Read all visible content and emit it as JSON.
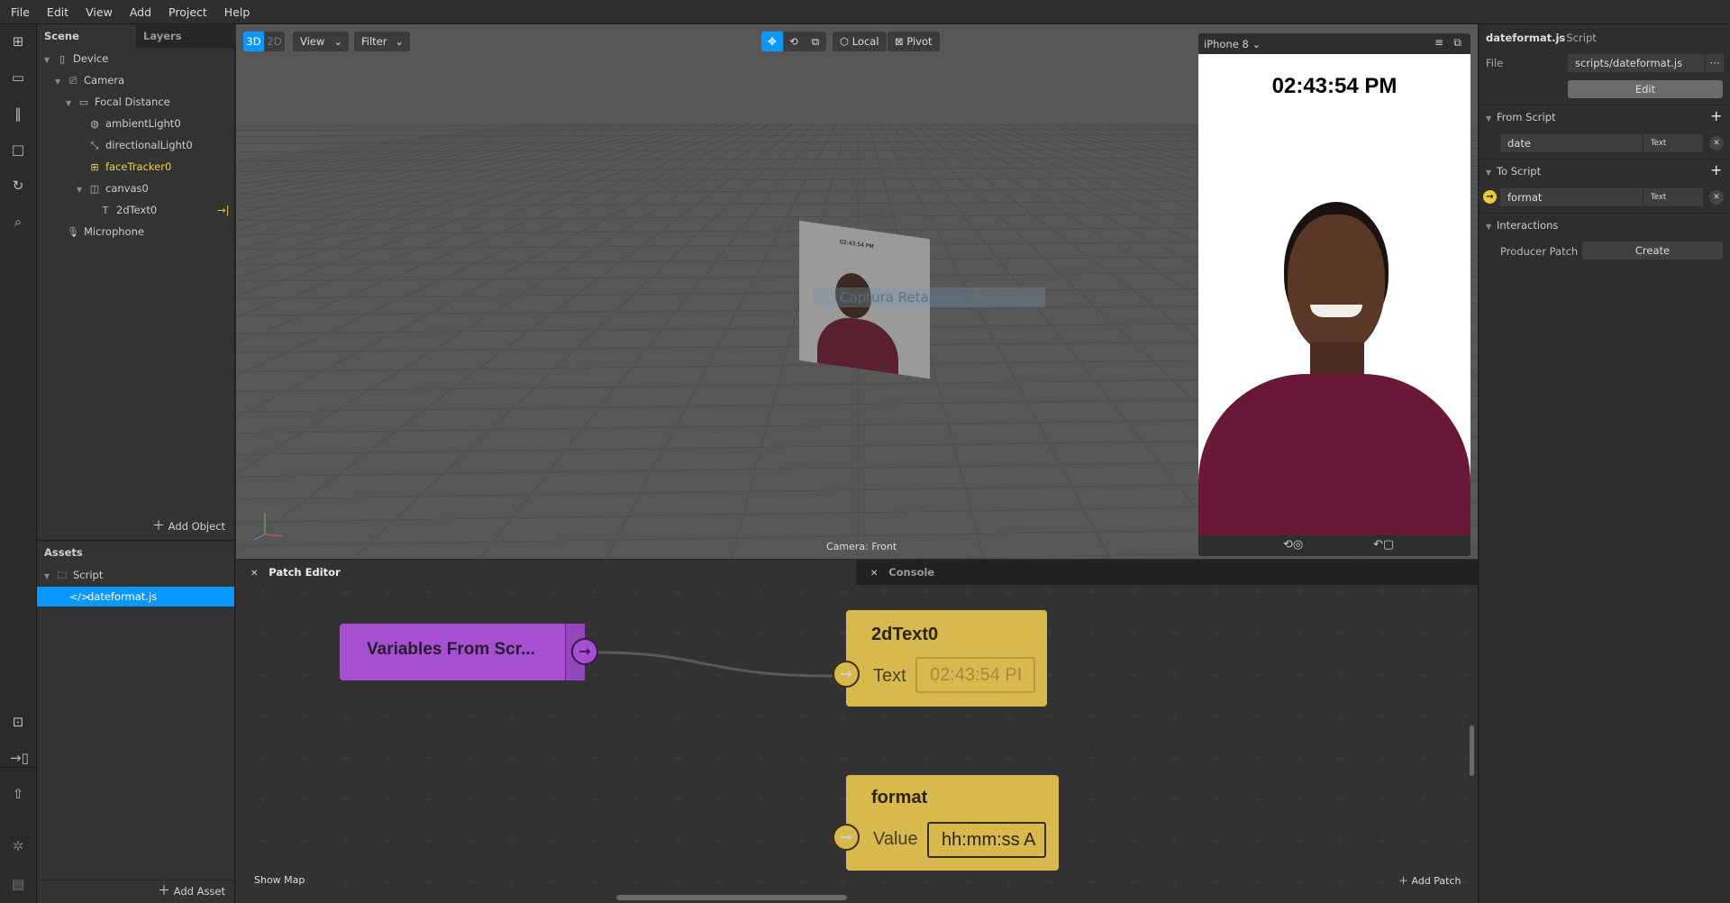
{
  "menu": [
    "File",
    "Edit",
    "View",
    "Add",
    "Project",
    "Help"
  ],
  "scene_panel": {
    "tabs": [
      "Scene",
      "Layers"
    ],
    "tree": [
      {
        "label": "Device",
        "icon": "phone-icon",
        "level": 0,
        "expanded": true
      },
      {
        "label": "Camera",
        "icon": "camera-icon",
        "level": 1,
        "expanded": true
      },
      {
        "label": "Focal Distance",
        "icon": "ruler-icon",
        "level": 2,
        "expanded": true
      },
      {
        "label": "ambientLight0",
        "icon": "globe-icon",
        "level": 3
      },
      {
        "label": "directionalLight0",
        "icon": "directional-light-icon",
        "level": 3
      },
      {
        "label": "faceTracker0",
        "icon": "face-tracker-icon",
        "level": 3,
        "highlight": "#e8d34a"
      },
      {
        "label": "canvas0",
        "icon": "canvas-icon",
        "level": 3,
        "expanded": true
      },
      {
        "label": "2dText0",
        "icon": "text-icon",
        "level": 4,
        "badge": "→|"
      },
      {
        "label": "Microphone",
        "icon": "microphone-icon",
        "level": 1
      }
    ],
    "add_object": "Add Object"
  },
  "assets_panel": {
    "title": "Assets",
    "folder": "Script",
    "file": "dateformat.js",
    "add_asset": "Add Asset"
  },
  "viewport": {
    "mode_3d": "3D",
    "mode_2d": "2D",
    "view": "View",
    "filter": "Filter",
    "local": "Local",
    "pivot": "Pivot",
    "camera_label": "Camera: Front",
    "plane_text": "02:43:54 PM",
    "overlay_text": "Captura Retangular"
  },
  "preview": {
    "device": "iPhone 8",
    "time_text": "02:43:54 PM"
  },
  "inspector": {
    "title": "dateformat.js",
    "subtitle": "– Script",
    "file_label": "File",
    "file_value": "scripts/dateformat.js",
    "more": "···",
    "edit": "Edit",
    "from_script": {
      "title": "From Script",
      "name": "date",
      "type": "Text"
    },
    "to_script": {
      "title": "To Script",
      "name": "format",
      "type": "Text"
    },
    "interactions": {
      "title": "Interactions",
      "producer_label": "Producer Patch",
      "create": "Create"
    }
  },
  "patch_editor": {
    "tab": "Patch Editor",
    "console_tab": "Console",
    "show_map": "Show Map",
    "add_patch": "Add Patch",
    "nodes": {
      "variables": {
        "title": "Variables From Scr..."
      },
      "text_node": {
        "title": "2dText0",
        "port_label": "Text",
        "value": "02:43:54 PI"
      },
      "format_node": {
        "title": "format",
        "port_label": "Value",
        "value": "hh:mm:ss A"
      }
    }
  },
  "colors": {
    "accent": "#0a98ff",
    "patch_purple": "#a64fd0",
    "patch_yellow": "#d8b94e",
    "highlight_yellow": "#e8d34a"
  }
}
